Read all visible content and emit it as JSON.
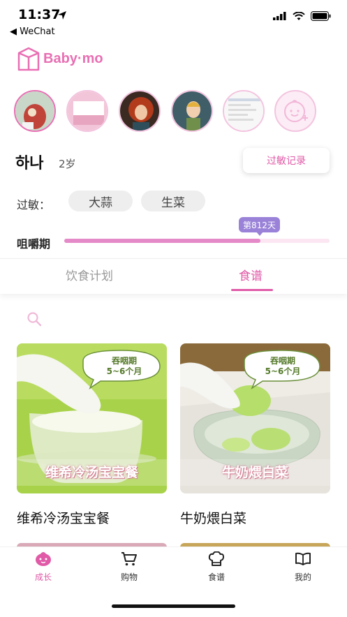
{
  "status_bar": {
    "time": "11:37",
    "back_label": "◀ WeChat"
  },
  "logo": {
    "text": "Baby·mo"
  },
  "profile": {
    "name": "하나",
    "age": "2岁",
    "allergy_button": "过敏记录",
    "allergy_label": "过敏：",
    "allergies": [
      "大蒜",
      "生菜"
    ],
    "stage_label": "咀嚼期",
    "day_badge": "第812天",
    "progress": 0.74
  },
  "tabs": [
    {
      "label": "饮食计划",
      "active": false
    },
    {
      "label": "食谱",
      "active": true
    }
  ],
  "recipes": [
    {
      "title": "维希冷汤宝宝餐",
      "overlay_text": "维希冷汤宝宝餐",
      "stage_line1": "吞咽期",
      "stage_line2": "5~6个月"
    },
    {
      "title": "牛奶煨白菜",
      "overlay_text": "牛奶煨白菜",
      "stage_line1": "吞咽期",
      "stage_line2": "5~6个月"
    }
  ],
  "nav": [
    {
      "label": "成长",
      "icon": "baby-face-icon",
      "active": true
    },
    {
      "label": "购物",
      "icon": "cart-icon",
      "active": false
    },
    {
      "label": "食谱",
      "icon": "chef-hat-icon",
      "active": false
    },
    {
      "label": "我的",
      "icon": "book-icon",
      "active": false
    }
  ],
  "colors": {
    "accent": "#e05aa7",
    "progress_fill": "#e58ac8",
    "badge": "#9a82d8"
  }
}
